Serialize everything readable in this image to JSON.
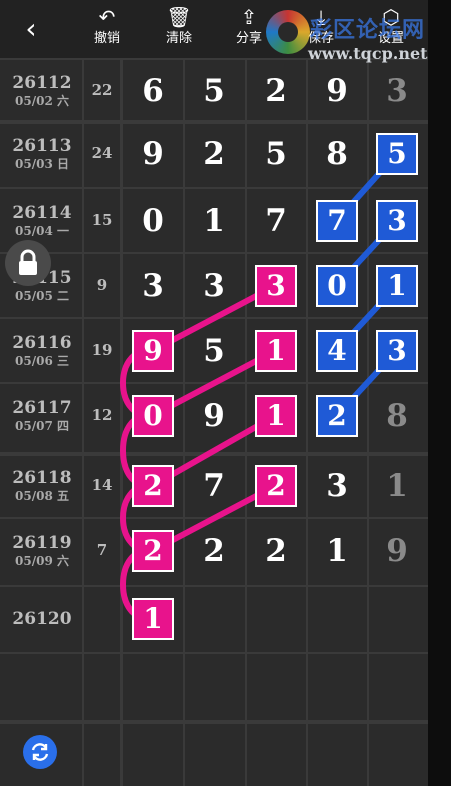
{
  "toolbar": {
    "back": "‹",
    "buttons": [
      {
        "label": "撤销",
        "icon": "↶"
      },
      {
        "label": "清除",
        "icon": "🗑"
      },
      {
        "label": "分享",
        "icon": "⇪"
      },
      {
        "label": "保存",
        "icon": "⤓"
      },
      {
        "label": "设置",
        "icon": "⬡"
      }
    ]
  },
  "watermark": {
    "name": "彩区论坛网",
    "url": "www.tqcp.net"
  },
  "rows": [
    {
      "period": "26112",
      "date": "05/02 六",
      "sum": "22",
      "digits": [
        "6",
        "5",
        "2",
        "9",
        "3"
      ]
    },
    {
      "period": "26113",
      "date": "05/03 日",
      "sum": "24",
      "digits": [
        "9",
        "2",
        "5",
        "8",
        "5"
      ]
    },
    {
      "period": "26114",
      "date": "05/04 一",
      "sum": "15",
      "digits": [
        "0",
        "1",
        "7",
        "7",
        "3"
      ]
    },
    {
      "period": "26115",
      "date": "05/05 二",
      "sum": "9",
      "digits": [
        "3",
        "3",
        "3",
        "0",
        "1"
      ]
    },
    {
      "period": "26116",
      "date": "05/06 三",
      "sum": "19",
      "digits": [
        "9",
        "5",
        "1",
        "4",
        "3"
      ]
    },
    {
      "period": "26117",
      "date": "05/07 四",
      "sum": "12",
      "digits": [
        "0",
        "9",
        "1",
        "2",
        "8"
      ]
    },
    {
      "period": "26118",
      "date": "05/08 五",
      "sum": "14",
      "digits": [
        "2",
        "7",
        "2",
        "3",
        "1"
      ]
    },
    {
      "period": "26119",
      "date": "05/09 六",
      "sum": "7",
      "digits": [
        "2",
        "2",
        "2",
        "1",
        "9"
      ]
    },
    {
      "period": "26120",
      "date": "",
      "sum": "",
      "digits": [
        "1",
        "",
        "",
        "",
        ""
      ]
    }
  ],
  "highlights": {
    "pink": [
      [
        3,
        2
      ],
      [
        4,
        0
      ],
      [
        4,
        2
      ],
      [
        5,
        0
      ],
      [
        5,
        2
      ],
      [
        6,
        0
      ],
      [
        6,
        2
      ],
      [
        7,
        0
      ],
      [
        8,
        0
      ]
    ],
    "blue": [
      [
        1,
        4
      ],
      [
        2,
        3
      ],
      [
        2,
        4
      ],
      [
        3,
        3
      ],
      [
        3,
        4
      ],
      [
        4,
        3
      ],
      [
        4,
        4
      ],
      [
        5,
        3
      ]
    ],
    "dim_column": 4
  },
  "colors": {
    "pink": "#e8138c",
    "blue": "#1f5ad6",
    "background": "#2b2b2b"
  }
}
